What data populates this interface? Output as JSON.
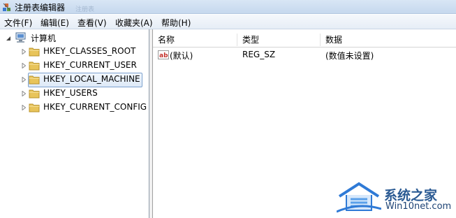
{
  "window": {
    "title": "注册表编辑器",
    "ghost_title": "注册表"
  },
  "menu": [
    {
      "label": "文件(F)"
    },
    {
      "label": "编辑(E)"
    },
    {
      "label": "查看(V)"
    },
    {
      "label": "收藏夹(A)"
    },
    {
      "label": "帮助(H)"
    }
  ],
  "tree": {
    "root": {
      "label": "计算机",
      "icon": "computer-icon",
      "expanded": true
    },
    "items": [
      {
        "label": "HKEY_CLASSES_ROOT",
        "icon": "folder-icon"
      },
      {
        "label": "HKEY_CURRENT_USER",
        "icon": "folder-icon"
      },
      {
        "label": "HKEY_LOCAL_MACHINE",
        "icon": "folder-icon",
        "selected": true
      },
      {
        "label": "HKEY_USERS",
        "icon": "folder-icon"
      },
      {
        "label": "HKEY_CURRENT_CONFIG",
        "icon": "folder-icon"
      }
    ]
  },
  "list": {
    "columns": [
      "名称",
      "类型",
      "数据"
    ],
    "rows": [
      {
        "name": "(默认)",
        "type": "REG_SZ",
        "data": "(数值未设置)",
        "icon": "string-value-icon"
      }
    ]
  },
  "watermark": {
    "brand": "系统之家",
    "url": "Win10net.com",
    "icon": "house-logo-icon"
  },
  "colors": {
    "selection_border": "#7da2ce",
    "folder": "#e8c45a",
    "watermark": "#2a5a93"
  }
}
